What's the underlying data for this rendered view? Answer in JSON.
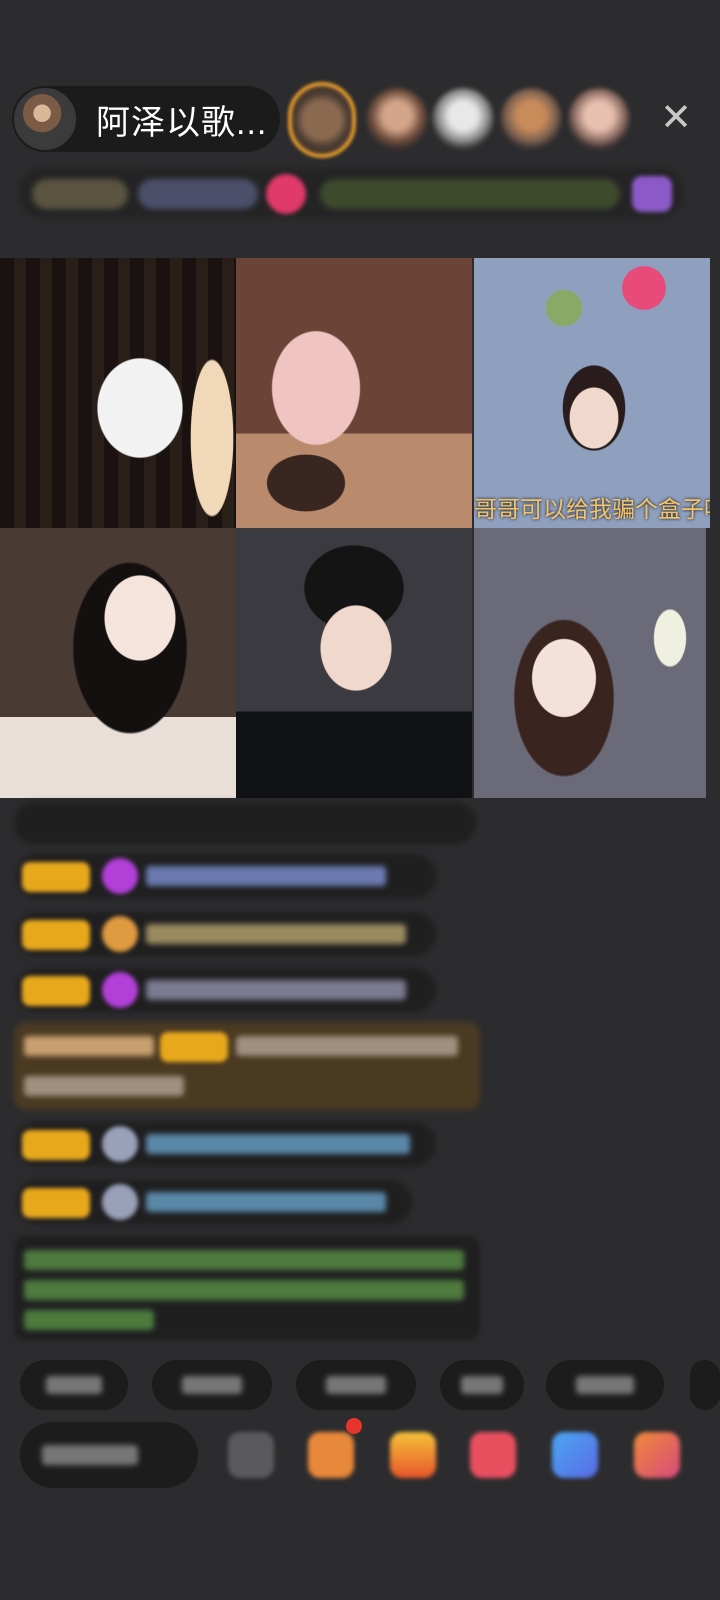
{
  "host": {
    "name": "阿泽以歌..."
  },
  "top_bar": {
    "close_icon": "close-icon"
  },
  "video_grid": {
    "tiles": [
      {
        "caption": ""
      },
      {
        "caption": ""
      },
      {
        "caption": "哥哥可以给我骗个盒子吗"
      },
      {
        "caption": ""
      },
      {
        "caption": ""
      },
      {
        "caption": ""
      }
    ]
  },
  "colors": {
    "background": "#2c2c2e",
    "badge": "#e8a81c",
    "viewer_ring": "#e59a2a",
    "caption": "#f5c46a",
    "notification_dot": "#e8352b"
  },
  "bottom_bar": {
    "tools": [
      "more-icon",
      "gift-box-icon",
      "gift-icon",
      "red-packet-icon",
      "chat-bubble-icon",
      "grid-icon"
    ]
  }
}
